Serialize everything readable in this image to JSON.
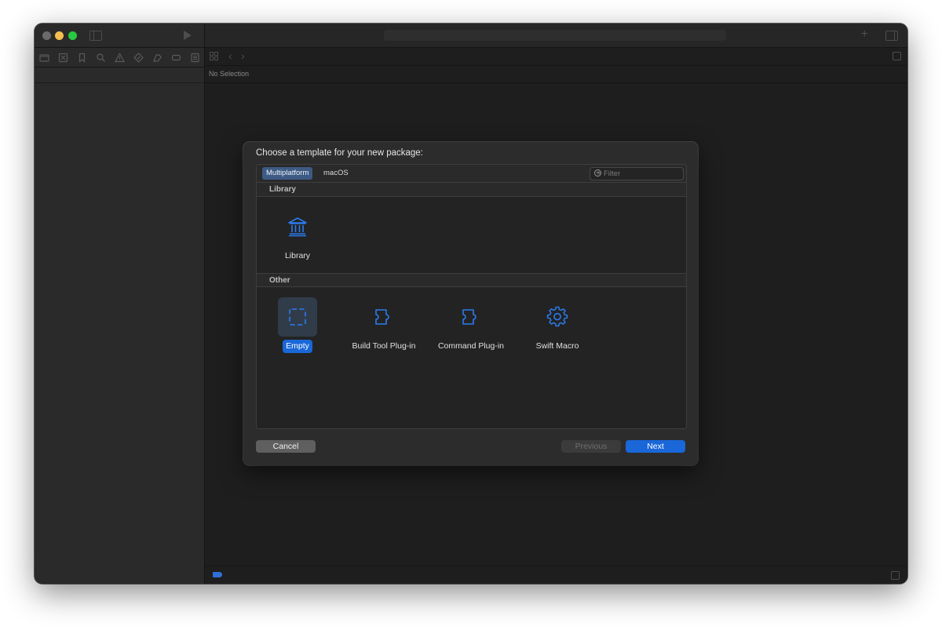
{
  "editor": {
    "breadcrumb": "No Selection"
  },
  "sheet": {
    "title": "Choose a template for your new package:",
    "tabs": [
      {
        "label": "Multiplatform",
        "selected": true
      },
      {
        "label": "macOS",
        "selected": false
      }
    ],
    "filter": {
      "placeholder": "Filter",
      "value": ""
    },
    "sections": [
      {
        "heading": "Library",
        "templates": [
          {
            "label": "Library",
            "icon": "building-columns-icon",
            "selected": false
          }
        ]
      },
      {
        "heading": "Other",
        "templates": [
          {
            "label": "Empty",
            "icon": "dashed-square-icon",
            "selected": true
          },
          {
            "label": "Build Tool Plug-in",
            "icon": "puzzle-piece-icon",
            "selected": false
          },
          {
            "label": "Command Plug-in",
            "icon": "puzzle-piece-icon",
            "selected": false
          },
          {
            "label": "Swift Macro",
            "icon": "gear-icon",
            "selected": false
          }
        ]
      }
    ],
    "buttons": {
      "cancel": "Cancel",
      "previous": "Previous",
      "next": "Next"
    }
  },
  "colors": {
    "accent": "#1a67d9",
    "icon_blue": "#2a7cf0",
    "selected_tab": "#3d5a84",
    "window_bg": "#1e1e1e"
  }
}
